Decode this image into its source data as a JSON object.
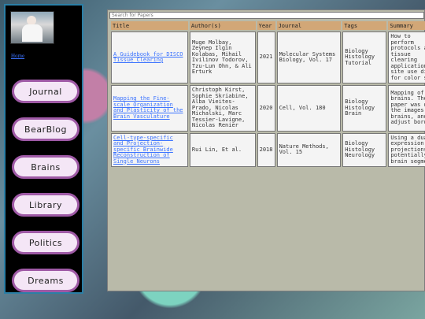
{
  "sidebar": {
    "home_label": "Home",
    "nav": [
      "Journal",
      "BearBlog",
      "Brains",
      "Library",
      "Politics",
      "Dreams"
    ]
  },
  "search": {
    "placeholder": "Search for Papers"
  },
  "table": {
    "headers": [
      "Title",
      "Author(s)",
      "Year",
      "Journal",
      "Tags",
      "Summary"
    ],
    "rows": [
      {
        "title": "A Guidebook for DISCO Tissue Clearing",
        "authors": "Muge Molbay, Zeynep Ilgin Kolabas, Mihail Ivilinov Todorov, Tzu-Lun Ohn, & Ali Erturk",
        "year": "2021",
        "journal": "Molecular Systems Biology, Vol. 17",
        "tags": "Biology Histology Tutorial",
        "summary": "How to perform protocols and tissue clearing applications site use dis for color se"
      },
      {
        "title": "Mapping the Fine-scale Organization and Plasticity of the Brain Vasculature",
        "authors": "Christoph Kirst, Sophie Skriabine, Alba Vieites-Prado, Nicolas Michalski, Marc Tessier-Lavigne, Nicolas Renier",
        "year": "2020",
        "journal": "Cell, Vol. 180",
        "tags": "Biology Histology Brain",
        "summary": "Mapping of t brains. The paper was do the images c brains, and adjust borde"
      },
      {
        "title": "Cell-type-specific and Projection-specific Brainwide Reconstruction of Single Neurons",
        "authors": "Rui Lin, Et al.",
        "year": "2018",
        "journal": "Nature Methods, Vol. 15",
        "tags": "Biology Histology Neurology",
        "summary": "Using a dual expression s projections potentially brain segmen"
      }
    ]
  }
}
